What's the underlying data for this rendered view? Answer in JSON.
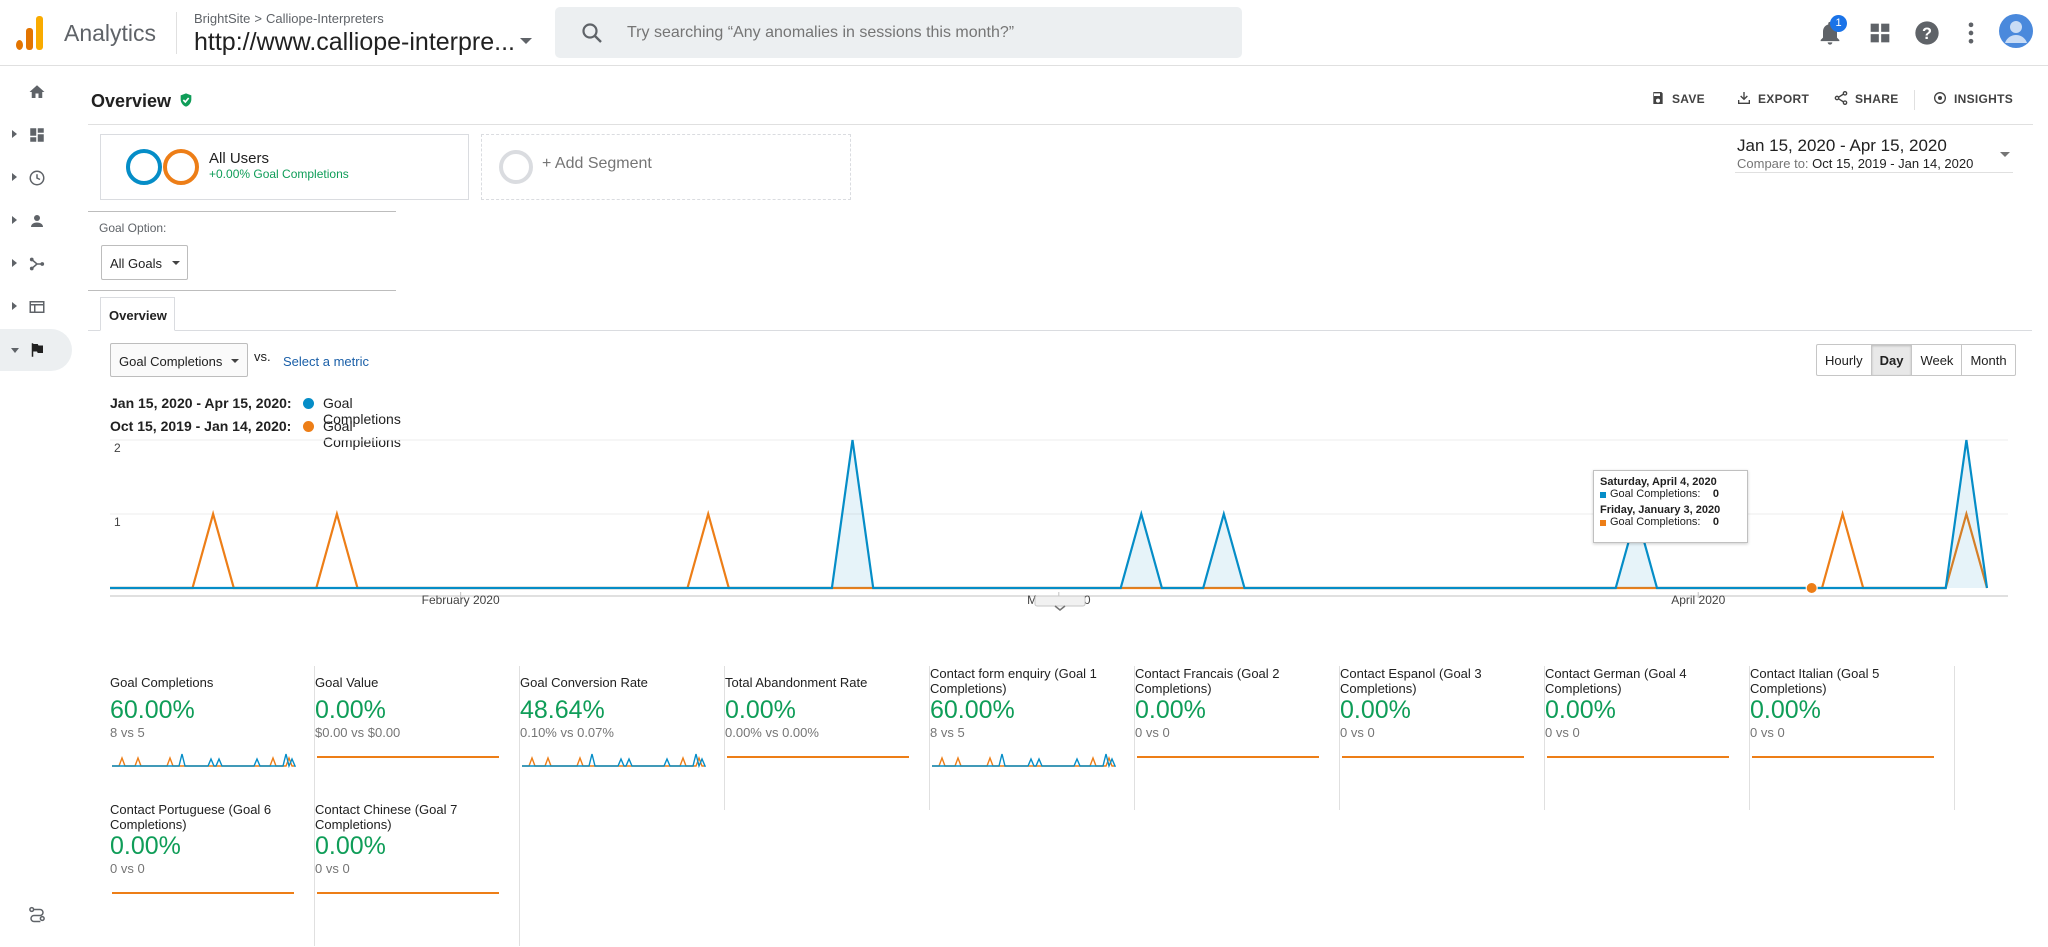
{
  "header": {
    "app_name": "Analytics",
    "breadcrumb": {
      "account": "BrightSite",
      "separator": ">",
      "property": "Calliope-Interpreters"
    },
    "property_url": "http://www.calliope-interpre...",
    "search_placeholder": "Try searching “Any anomalies in sessions this month?”",
    "notification_count": "1"
  },
  "page": {
    "title": "Overview",
    "actions": {
      "save": "SAVE",
      "export": "EXPORT",
      "share": "SHARE",
      "insights": "INSIGHTS"
    }
  },
  "segments": {
    "all_users_title": "All Users",
    "all_users_sub": "+0.00% Goal Completions",
    "add_segment": "+ Add Segment"
  },
  "date": {
    "range": "Jan 15, 2020 - Apr 15, 2020",
    "compare_label": "Compare to:",
    "compare_range": "Oct 15, 2019 - Jan 14, 2020"
  },
  "goal_option": {
    "label": "Goal Option:",
    "value": "All Goals"
  },
  "tabs": {
    "overview": "Overview"
  },
  "metric_bar": {
    "metric": "Goal Completions",
    "vs": "vs.",
    "select_metric": "Select a metric",
    "granularity": [
      "Hourly",
      "Day",
      "Week",
      "Month"
    ],
    "active_granularity": "Day"
  },
  "legend": [
    {
      "dates": "Jan 15, 2020 - Apr 15, 2020:",
      "metric": "Goal Completions",
      "color": "#058dc7"
    },
    {
      "dates": "Oct 15, 2019 - Jan 14, 2020:",
      "metric": "Goal Completions",
      "color": "#ed7e17"
    }
  ],
  "chart_data": {
    "type": "area",
    "y_ticks": [
      "2",
      "1"
    ],
    "ylim": [
      0,
      2
    ],
    "x_tick_labels": [
      {
        "label": "February 2020",
        "day": 17
      },
      {
        "label": "March 2020",
        "day": 46
      },
      {
        "label": "April 2020",
        "day": 77
      }
    ],
    "days": 92,
    "series": [
      {
        "name": "Goal Completions",
        "color": "#058dc7",
        "peaks": [
          [
            36,
            2
          ],
          [
            50,
            1
          ],
          [
            54,
            1
          ],
          [
            74,
            1
          ],
          [
            90,
            2
          ]
        ]
      },
      {
        "name": "Goal Completions",
        "color": "#ed7e17",
        "peaks": [
          [
            5,
            1
          ],
          [
            11,
            1
          ],
          [
            29,
            1
          ],
          [
            84,
            1
          ],
          [
            90,
            1
          ]
        ]
      }
    ],
    "tooltip": {
      "date1": "Saturday, April 4, 2020",
      "label1": "Goal Completions:",
      "value1": "0",
      "date2": "Friday, January 3, 2020",
      "label2": "Goal Completions:",
      "value2": "0"
    }
  },
  "scorecards": [
    {
      "title": "Goal Completions",
      "percent": "60.00%",
      "compare": "8 vs 5",
      "spark": "spiky"
    },
    {
      "title": "Goal Value",
      "percent": "0.00%",
      "compare": "$0.00 vs $0.00",
      "spark": "flat"
    },
    {
      "title": "Goal Conversion Rate",
      "percent": "48.64%",
      "compare": "0.10% vs 0.07%",
      "spark": "spiky"
    },
    {
      "title": "Total Abandonment Rate",
      "percent": "0.00%",
      "compare": "0.00% vs 0.00%",
      "spark": "flat"
    },
    {
      "title": "Contact form enquiry (Goal 1 Completions)",
      "percent": "60.00%",
      "compare": "8 vs 5",
      "spark": "spiky"
    },
    {
      "title": "Contact Francais (Goal 2 Completions)",
      "percent": "0.00%",
      "compare": "0 vs 0",
      "spark": "flat"
    },
    {
      "title": "Contact Espanol (Goal 3 Completions)",
      "percent": "0.00%",
      "compare": "0 vs 0",
      "spark": "flat"
    },
    {
      "title": "Contact German (Goal 4 Completions)",
      "percent": "0.00%",
      "compare": "0 vs 0",
      "spark": "flat"
    },
    {
      "title": "Contact Italian (Goal 5 Completions)",
      "percent": "0.00%",
      "compare": "0 vs 0",
      "spark": "flat"
    },
    {
      "title": "Contact Portuguese (Goal 6 Completions)",
      "percent": "0.00%",
      "compare": "0 vs 0",
      "spark": "flat"
    },
    {
      "title": "Contact Chinese (Goal 7 Completions)",
      "percent": "0.00%",
      "compare": "0 vs 0",
      "spark": "flat"
    }
  ],
  "icons": {
    "nav": [
      "home-icon",
      "dashboard-icon",
      "realtime-clock-icon",
      "audience-person-icon",
      "acquisition-icon",
      "behavior-icon",
      "conversions-flag-icon",
      "admin-icon"
    ],
    "top": [
      "notifications-bell-icon",
      "apps-grid-icon",
      "help-icon",
      "more-vert-icon",
      "account-avatar-icon"
    ]
  }
}
